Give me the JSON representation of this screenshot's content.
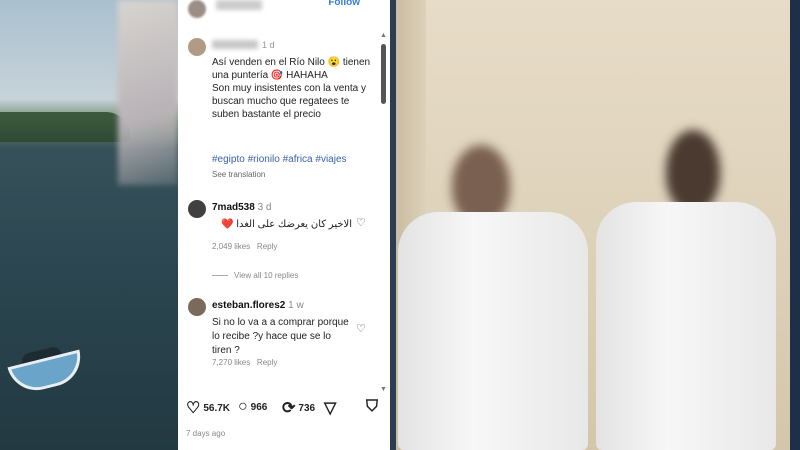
{
  "post": {
    "follow_label": "Follow",
    "caption_time": "1 d",
    "caption": "Así venden en el Río Nilo 😮 tienen una puntería 🎯 HAHAHA\nSon muy insistentes con la venta y buscan mucho que regatees te suben bastante el precio",
    "hashtags": "#egipto #rionilo #africa #viajes",
    "see_translation": "See translation"
  },
  "comments": [
    {
      "author": "7mad538",
      "time": "3 d",
      "text": "الاخير كان يعرضك على الغدا ❤️",
      "likes": "2,049 likes",
      "reply": "Reply",
      "view_replies": "View all 10 replies"
    },
    {
      "author": "esteban.flores2",
      "time": "1 w",
      "text": "Si no lo va a a comprar porque lo recibe ?y hace que se lo tiren ?",
      "likes": "7,270 likes",
      "reply": "Reply"
    }
  ],
  "actions": {
    "likes": "56.7K",
    "comments": "966",
    "reposts": "736"
  },
  "posted": "7 days ago",
  "icons": [
    "heart-icon",
    "comment-icon",
    "repost-icon",
    "send-icon",
    "bookmark-icon"
  ]
}
